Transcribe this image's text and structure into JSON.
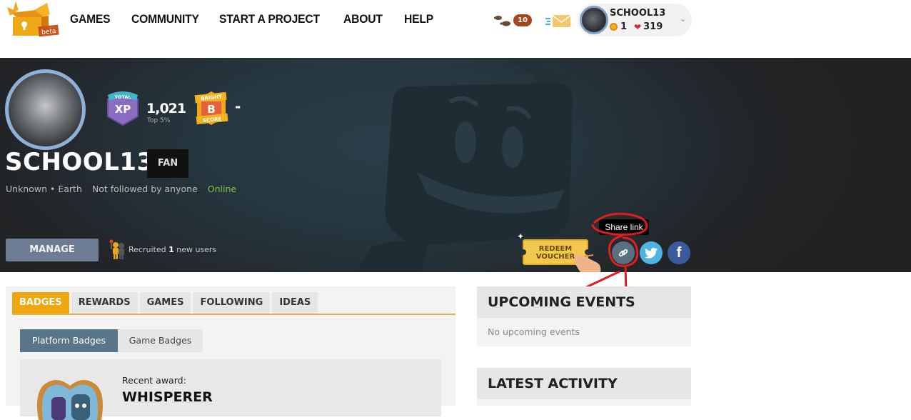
{
  "nav": {
    "logo_badge": "beta",
    "links": [
      "GAMES",
      "COMMUNITY",
      "START A PROJECT",
      "ABOUT",
      "HELP"
    ],
    "quest_count": "10",
    "user": {
      "name": "SCHOOL13",
      "coins": "1",
      "hearts": "319"
    }
  },
  "profile": {
    "username": "SCHOOL13",
    "role": "FAN",
    "xp_badge": {
      "top": "TOTAL",
      "main": "XP"
    },
    "xp_value": "1,021",
    "xp_rank": "Top 5%",
    "bright_badge": {
      "top": "BRIGHT",
      "main": "B",
      "bottom": "SCORE"
    },
    "bright_value": "-",
    "location": "Unknown • Earth",
    "followers": "Not followed by anyone",
    "status": "Online",
    "manage_label": "MANAGE",
    "recruit": {
      "prefix": "Recruited ",
      "count": "1",
      "suffix": " new users"
    },
    "voucher_line1": "REDEEM",
    "voucher_line2": "VOUCHER",
    "share_tooltip": "Share link"
  },
  "colors": {
    "accent": "#efa70f",
    "online": "#7dc14b",
    "share": "#5a6f82",
    "twitter": "#4fb3e6",
    "facebook": "#3b5a9c",
    "annotation": "#e11d1d"
  },
  "tabs": [
    {
      "label": "BADGES",
      "active": true
    },
    {
      "label": "REWARDS",
      "active": false
    },
    {
      "label": "GAMES",
      "active": false
    },
    {
      "label": "FOLLOWING",
      "active": false
    },
    {
      "label": "IDEAS",
      "active": false
    }
  ],
  "subtabs": [
    {
      "label": "Platform Badges",
      "active": true
    },
    {
      "label": "Game Badges",
      "active": false
    }
  ],
  "recent_award": {
    "label": "Recent award:",
    "name": "WHISPERER"
  },
  "sidebar": {
    "events_title": "UPCOMING EVENTS",
    "events_empty": "No upcoming events",
    "activity_title": "LATEST ACTIVITY"
  }
}
